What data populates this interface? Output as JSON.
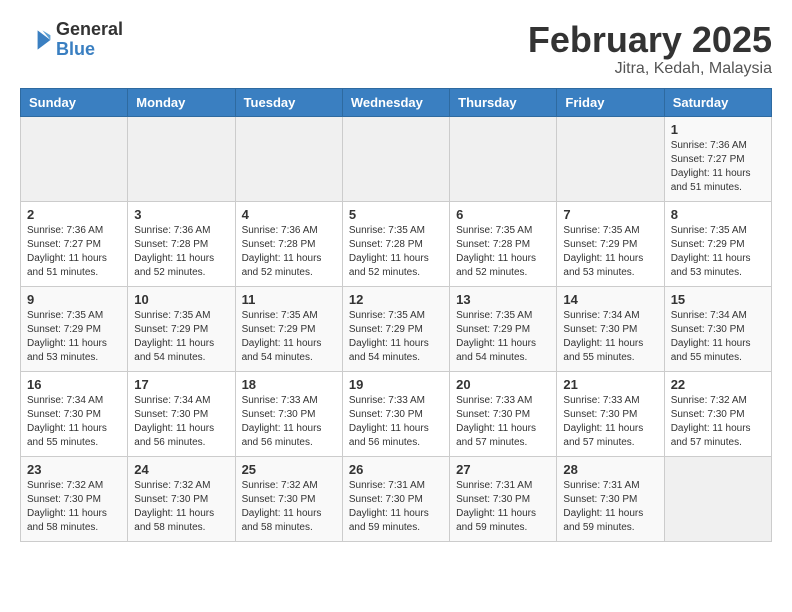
{
  "header": {
    "logo": {
      "general": "General",
      "blue": "Blue"
    },
    "title": "February 2025",
    "location": "Jitra, Kedah, Malaysia"
  },
  "calendar": {
    "days_of_week": [
      "Sunday",
      "Monday",
      "Tuesday",
      "Wednesday",
      "Thursday",
      "Friday",
      "Saturday"
    ],
    "weeks": [
      [
        {
          "day": "",
          "empty": true
        },
        {
          "day": "",
          "empty": true
        },
        {
          "day": "",
          "empty": true
        },
        {
          "day": "",
          "empty": true
        },
        {
          "day": "",
          "empty": true
        },
        {
          "day": "",
          "empty": true
        },
        {
          "day": "1",
          "sunrise": "7:36 AM",
          "sunset": "7:27 PM",
          "daylight": "11 hours and 51 minutes."
        }
      ],
      [
        {
          "day": "2",
          "sunrise": "7:36 AM",
          "sunset": "7:27 PM",
          "daylight": "11 hours and 51 minutes."
        },
        {
          "day": "3",
          "sunrise": "7:36 AM",
          "sunset": "7:28 PM",
          "daylight": "11 hours and 52 minutes."
        },
        {
          "day": "4",
          "sunrise": "7:36 AM",
          "sunset": "7:28 PM",
          "daylight": "11 hours and 52 minutes."
        },
        {
          "day": "5",
          "sunrise": "7:35 AM",
          "sunset": "7:28 PM",
          "daylight": "11 hours and 52 minutes."
        },
        {
          "day": "6",
          "sunrise": "7:35 AM",
          "sunset": "7:28 PM",
          "daylight": "11 hours and 52 minutes."
        },
        {
          "day": "7",
          "sunrise": "7:35 AM",
          "sunset": "7:29 PM",
          "daylight": "11 hours and 53 minutes."
        },
        {
          "day": "8",
          "sunrise": "7:35 AM",
          "sunset": "7:29 PM",
          "daylight": "11 hours and 53 minutes."
        }
      ],
      [
        {
          "day": "9",
          "sunrise": "7:35 AM",
          "sunset": "7:29 PM",
          "daylight": "11 hours and 53 minutes."
        },
        {
          "day": "10",
          "sunrise": "7:35 AM",
          "sunset": "7:29 PM",
          "daylight": "11 hours and 54 minutes."
        },
        {
          "day": "11",
          "sunrise": "7:35 AM",
          "sunset": "7:29 PM",
          "daylight": "11 hours and 54 minutes."
        },
        {
          "day": "12",
          "sunrise": "7:35 AM",
          "sunset": "7:29 PM",
          "daylight": "11 hours and 54 minutes."
        },
        {
          "day": "13",
          "sunrise": "7:35 AM",
          "sunset": "7:29 PM",
          "daylight": "11 hours and 54 minutes."
        },
        {
          "day": "14",
          "sunrise": "7:34 AM",
          "sunset": "7:30 PM",
          "daylight": "11 hours and 55 minutes."
        },
        {
          "day": "15",
          "sunrise": "7:34 AM",
          "sunset": "7:30 PM",
          "daylight": "11 hours and 55 minutes."
        }
      ],
      [
        {
          "day": "16",
          "sunrise": "7:34 AM",
          "sunset": "7:30 PM",
          "daylight": "11 hours and 55 minutes."
        },
        {
          "day": "17",
          "sunrise": "7:34 AM",
          "sunset": "7:30 PM",
          "daylight": "11 hours and 56 minutes."
        },
        {
          "day": "18",
          "sunrise": "7:33 AM",
          "sunset": "7:30 PM",
          "daylight": "11 hours and 56 minutes."
        },
        {
          "day": "19",
          "sunrise": "7:33 AM",
          "sunset": "7:30 PM",
          "daylight": "11 hours and 56 minutes."
        },
        {
          "day": "20",
          "sunrise": "7:33 AM",
          "sunset": "7:30 PM",
          "daylight": "11 hours and 57 minutes."
        },
        {
          "day": "21",
          "sunrise": "7:33 AM",
          "sunset": "7:30 PM",
          "daylight": "11 hours and 57 minutes."
        },
        {
          "day": "22",
          "sunrise": "7:32 AM",
          "sunset": "7:30 PM",
          "daylight": "11 hours and 57 minutes."
        }
      ],
      [
        {
          "day": "23",
          "sunrise": "7:32 AM",
          "sunset": "7:30 PM",
          "daylight": "11 hours and 58 minutes."
        },
        {
          "day": "24",
          "sunrise": "7:32 AM",
          "sunset": "7:30 PM",
          "daylight": "11 hours and 58 minutes."
        },
        {
          "day": "25",
          "sunrise": "7:32 AM",
          "sunset": "7:30 PM",
          "daylight": "11 hours and 58 minutes."
        },
        {
          "day": "26",
          "sunrise": "7:31 AM",
          "sunset": "7:30 PM",
          "daylight": "11 hours and 59 minutes."
        },
        {
          "day": "27",
          "sunrise": "7:31 AM",
          "sunset": "7:30 PM",
          "daylight": "11 hours and 59 minutes."
        },
        {
          "day": "28",
          "sunrise": "7:31 AM",
          "sunset": "7:30 PM",
          "daylight": "11 hours and 59 minutes."
        },
        {
          "day": "",
          "empty": true
        }
      ]
    ]
  }
}
